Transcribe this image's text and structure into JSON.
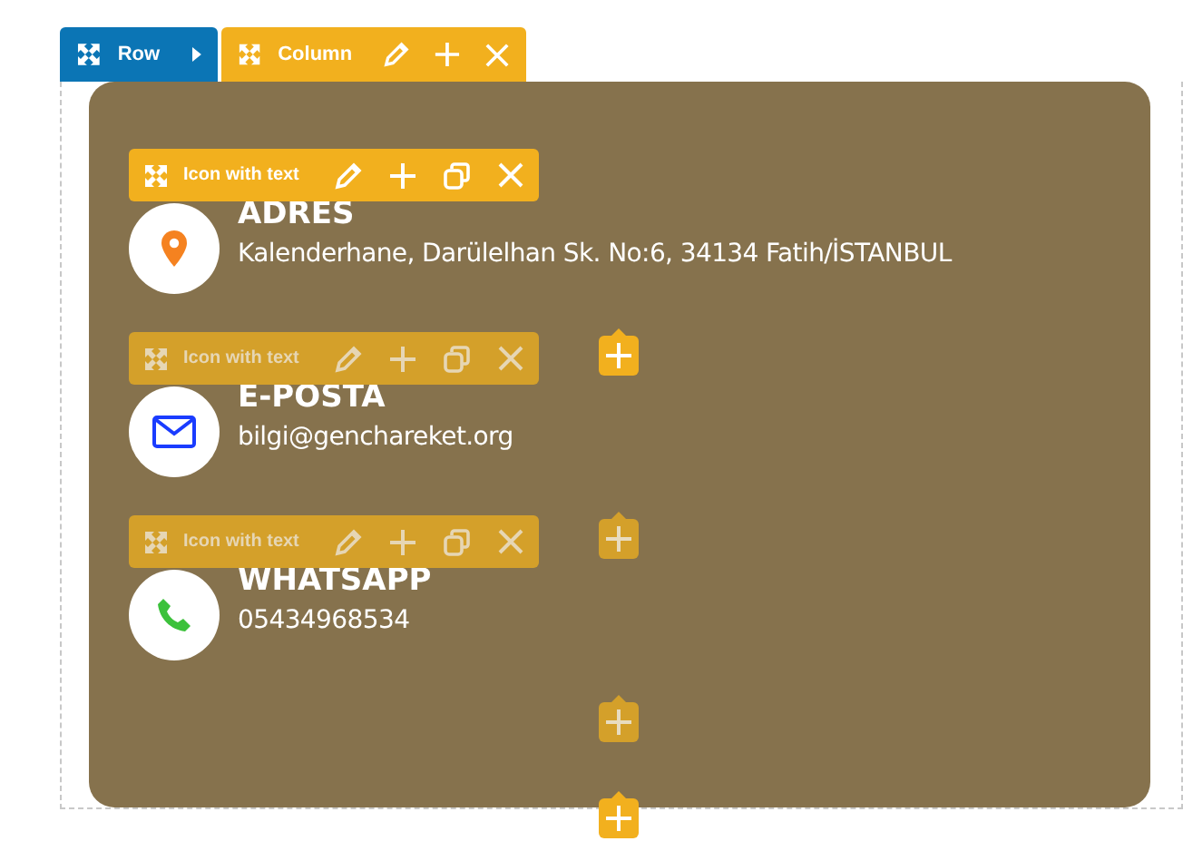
{
  "editor_bar": {
    "row_label": "Row",
    "column_label": "Column"
  },
  "items": [
    {
      "kind": "location",
      "toolbar_label": "Icon with text",
      "active": true,
      "title": "ADRES",
      "text": "Kalenderhane, Darülelhan Sk. No:6, 34134 Fatih/İSTANBUL"
    },
    {
      "kind": "email",
      "toolbar_label": "Icon with text",
      "active": false,
      "title": "E-POSTA",
      "text": "bilgi@genchareket.org"
    },
    {
      "kind": "phone",
      "toolbar_label": "Icon with text",
      "active": false,
      "title": "WHATSAPP",
      "text": "05434968534"
    }
  ],
  "add_buttons": [
    {
      "active": true
    },
    {
      "active": false
    },
    {
      "active": false
    },
    {
      "active": true
    }
  ]
}
